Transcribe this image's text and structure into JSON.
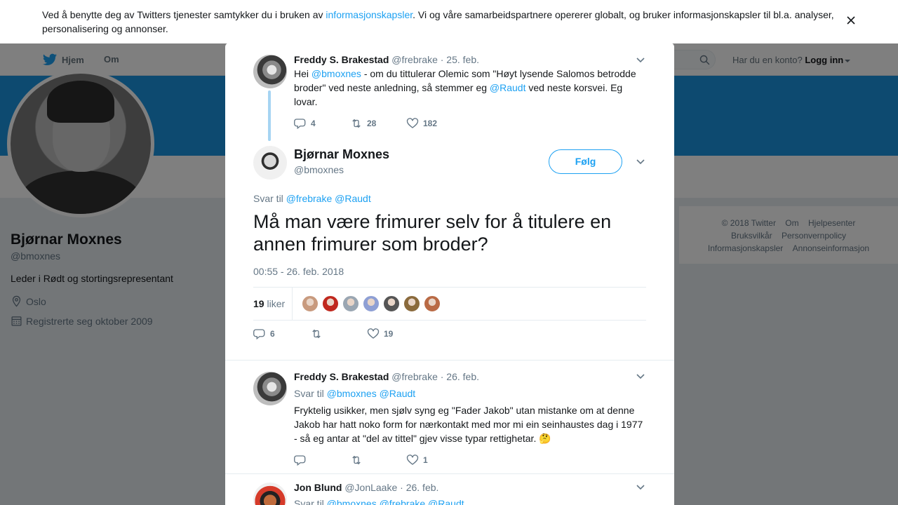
{
  "cookie": {
    "text_before": "Ved å benytte deg av Twitters tjenester samtykker du i bruken av ",
    "link": "informasjonskapsler",
    "text_after": ". Vi og våre samarbeidspartnere opererer globalt, og bruker informasjonskapsler til bl.a. analyser, personalisering og annonser."
  },
  "nav": {
    "home": "Hjem",
    "about": "Om",
    "account_prompt": "Har du en konto?",
    "login": "Logg inn"
  },
  "profile": {
    "name": "Bjørnar Moxnes",
    "handle": "@bmoxnes",
    "bio": "Leder i Rødt og stortingsrepresentant",
    "location": "Oslo",
    "joined": "Registrerte seg oktober 2009"
  },
  "footer": {
    "items": [
      "© 2018 Twitter",
      "Om",
      "Hjelpesenter",
      "Bruksvilkår",
      "Personvernpolicy",
      "Informasjonskapsler",
      "Annonseinformasjon"
    ]
  },
  "parent_tweet": {
    "name": "Freddy S. Brakestad",
    "handle": "@frebrake",
    "date": "· 25. feb.",
    "text_1": "Hei ",
    "mention_1": "@bmoxnes",
    "text_2": " - om du tittulerar Olemic som \"Høyt lysende Salomos betrodde broder\" ved neste anledning, så stemmer eg ",
    "mention_2": "@Raudt",
    "text_3": " ved neste korsvei. Eg lovar.",
    "replies": "4",
    "retweets": "28",
    "likes": "182"
  },
  "main_tweet": {
    "name": "Bjørnar Moxnes",
    "handle": "@bmoxnes",
    "follow": "Følg",
    "reply_label": "Svar til",
    "reply_mentions": "@frebrake @Raudt",
    "text": "Må man være frimurer selv for å titulere en annen frimurer som broder?",
    "timestamp": "00:55 - 26. feb. 2018",
    "likes_count": "19",
    "likes_label": "liker",
    "replies": "6",
    "retweets": "",
    "likes": "19",
    "liker_colors": [
      "#c89a7e",
      "#c0281e",
      "#9aa6b2",
      "#8e9fd4",
      "#555555",
      "#8a6a3c",
      "#b96a45"
    ]
  },
  "reply_1": {
    "name": "Freddy S. Brakestad",
    "handle": "@frebrake",
    "date": "· 26. feb.",
    "reply_label": "Svar til",
    "reply_mentions": "@bmoxnes @Raudt",
    "text": "Fryktelig usikker, men sjølv syng eg \"Fader Jakob\" utan mistanke om at denne Jakob har hatt noko form for nærkontakt med mor mi ein seinhaustes dag i 1977 - så eg antar at \"del av tittel\" gjev visse typar rettighetar. 🤔",
    "replies": "",
    "retweets": "",
    "likes": "1"
  },
  "reply_2": {
    "name": "Jon Blund",
    "handle": "@JonLaake",
    "date": "· 26. feb.",
    "reply_label": "Svar til",
    "reply_mentions": "@bmoxnes @frebrake @Raudt"
  }
}
